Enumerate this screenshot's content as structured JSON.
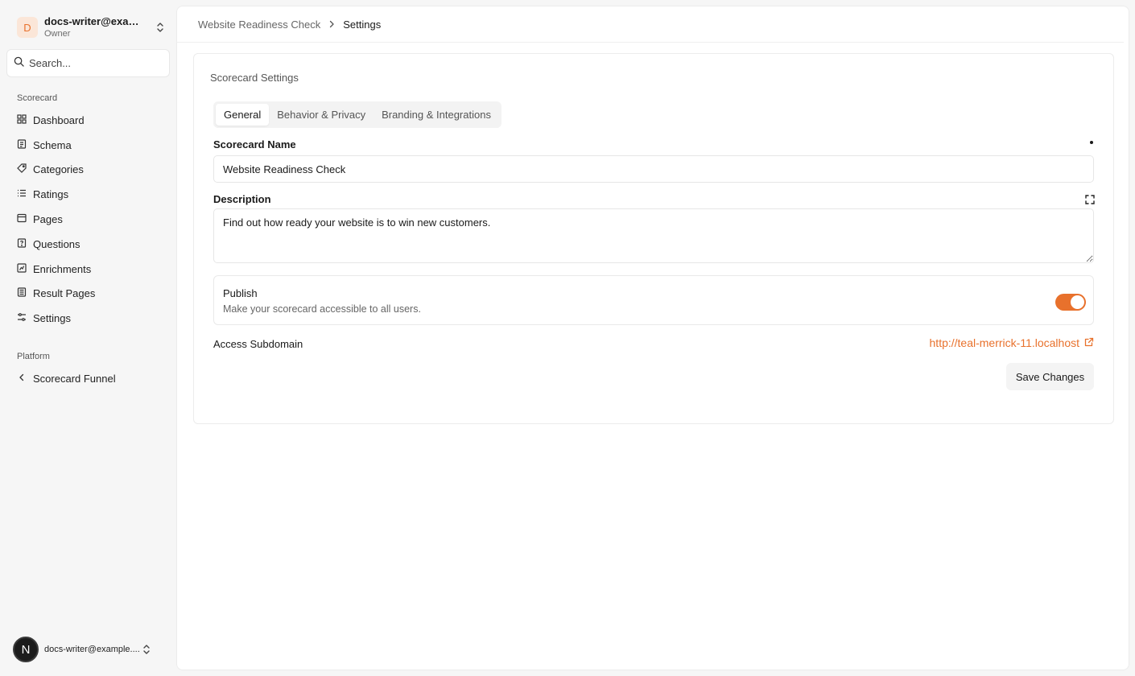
{
  "org": {
    "avatar_letter": "D",
    "name": "docs-writer@exam...",
    "role": "Owner"
  },
  "search": {
    "placeholder": "Search..."
  },
  "sidebar": {
    "section_scorecard": "Scorecard",
    "items": [
      {
        "label": "Dashboard",
        "icon": "grid-icon"
      },
      {
        "label": "Schema",
        "icon": "schema-icon"
      },
      {
        "label": "Categories",
        "icon": "tag-icon"
      },
      {
        "label": "Ratings",
        "icon": "list-icon"
      },
      {
        "label": "Pages",
        "icon": "page-icon"
      },
      {
        "label": "Questions",
        "icon": "question-icon"
      },
      {
        "label": "Enrichments",
        "icon": "enrich-icon"
      },
      {
        "label": "Result Pages",
        "icon": "result-icon"
      },
      {
        "label": "Settings",
        "icon": "sliders-icon"
      }
    ],
    "section_platform": "Platform",
    "platform_items": [
      {
        "label": "Scorecard Funnel",
        "icon": "chevron-left-icon"
      }
    ]
  },
  "user": {
    "avatar_letter": "N",
    "email": "docs-writer@example...."
  },
  "breadcrumb": {
    "parent": "Website Readiness Check",
    "current": "Settings"
  },
  "card": {
    "title": "Scorecard Settings",
    "tabs": [
      {
        "label": "General",
        "active": true
      },
      {
        "label": "Behavior & Privacy",
        "active": false
      },
      {
        "label": "Branding & Integrations",
        "active": false
      }
    ]
  },
  "form": {
    "name_label": "Scorecard Name",
    "name_value": "Website Readiness Check",
    "description_label": "Description",
    "description_value": "Find out how ready your website is to win new customers.",
    "publish_title": "Publish",
    "publish_desc": "Make your scorecard accessible to all users.",
    "publish_on": true,
    "subdomain_label": "Access Subdomain",
    "subdomain_url": "http://teal-merrick-11.localhost",
    "save_label": "Save Changes"
  },
  "colors": {
    "accent": "#e8712c",
    "accent_soft": "#fbe6d8"
  }
}
